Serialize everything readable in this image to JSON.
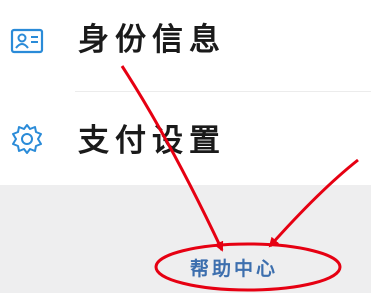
{
  "menu": {
    "items": [
      {
        "label": "身份信息",
        "icon": "id-card-icon"
      },
      {
        "label": "支付设置",
        "icon": "gear-icon"
      }
    ]
  },
  "help": {
    "label": "帮助中心"
  },
  "colors": {
    "icon_blue": "#2a8bd8",
    "link_blue": "#3d6fae",
    "annotation_red": "#e60012",
    "gray_bg": "#eeeeef"
  }
}
